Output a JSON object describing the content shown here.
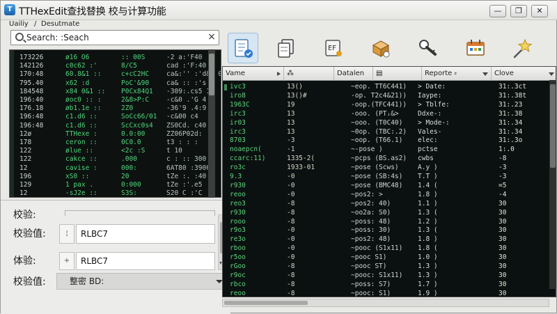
{
  "window": {
    "title": "TTHexEdit查找替换 校与计算功能",
    "minimize_glyph": "—",
    "maximize_glyph": "❐",
    "close_glyph": "✕"
  },
  "menu": {
    "items": [
      "Uailiy",
      "Desutmate"
    ],
    "separator": "/"
  },
  "search": {
    "value": "Search: :Seach",
    "placeholder": "Search",
    "clear_glyph": "×"
  },
  "hex_rows": [
    {
      "addr": "173226",
      "cols": [
        "ø16 O6",
        ":: 00S",
        "-2 a:'F40"
      ]
    },
    {
      "addr": "142126",
      "cols": [
        "c0c62 :'",
        "8/C5",
        "cad :'F:40"
      ]
    },
    {
      "addr": "170:48",
      "cols": [
        "60.8&1 ::",
        "c+cC2HC",
        "ca&:'' :'d&: 0"
      ]
    },
    {
      "addr": "795.40",
      "cols": [
        "x62 :d",
        "PoC'&90",
        "ca& :: :'s 1"
      ]
    },
    {
      "addr": "184548",
      "cols": [
        "x84 0&1 ::",
        "P0Cx84Q1",
        "-309:.cs5 1:"
      ]
    },
    {
      "addr": "196:40",
      "cols": [
        "øoc0 :: :",
        "2&8>P:C",
        "-c&0 .'G 4"
      ]
    },
    {
      "addr": "176.18",
      "cols": [
        "øb1.1e ::",
        "2Z0",
        "-36'9 .4:9"
      ]
    },
    {
      "addr": "196:48",
      "cols": [
        "c1.d6 ::",
        "SoCc66/01",
        "-c&00 c4"
      ]
    },
    {
      "addr": "196:48",
      "cols": [
        "c1.d6 ::",
        "ScCxc0s4",
        "ZS0Cd. c40"
      ]
    },
    {
      "addr": "12ø",
      "cols": [
        "TTHexe :",
        "0.0:00",
        "ZZ06P02d:"
      ]
    },
    {
      "addr": "178",
      "cols": [
        "ceron ::",
        "0C0.0",
        "t3 : : :"
      ]
    },
    {
      "addr": "122",
      "cols": [
        "ølue ::",
        "<2c :S",
        "t 10"
      ]
    },
    {
      "addr": "122",
      "cols": [
        "cakce ::",
        ".000",
        "c : :: 300"
      ]
    },
    {
      "addr": "12",
      "cols": [
        "cavise :",
        "000:",
        "6AT80 :3900"
      ]
    },
    {
      "addr": "196",
      "cols": [
        "xS0 ::",
        "20",
        "tZe :. :40"
      ]
    },
    {
      "addr": "129",
      "cols": [
        "1 pax .",
        "0:000",
        "tZe :'.e5"
      ]
    },
    {
      "addr": "12",
      "cols": [
        "-sJ2e ::",
        "S3S:",
        "S20 C :'C"
      ]
    }
  ],
  "form": {
    "label_1": "校验:",
    "label_2": "校验值:",
    "label_3": "体验:",
    "label_4": "校验值:",
    "field_2_value": "RLBC7",
    "field_3_value": "RLBC7",
    "spin_2": "¦",
    "spin_3": "+",
    "select_value": "整密 BD:",
    "scroll_arrow": "▾"
  },
  "toolbar": {
    "tools": [
      "checklist-icon",
      "copy-pages-icon",
      "hex-code-icon",
      "package-icon",
      "key-icon",
      "calendar-board-icon",
      "star-wand-icon"
    ]
  },
  "table": {
    "headers": [
      "Vame",
      "⁂",
      "Datalen",
      "▤",
      "Reporte ⸗",
      "Clove"
    ],
    "rows": [
      {
        "c1": "ivc3",
        "c2": "13()",
        "c3": "~eop. TT6C441)",
        "c4": "> Date:",
        "c5": "31:.3ct"
      },
      {
        "c1": "iro8",
        "c2": "13()#",
        "c3": "-op. T2c4&21))",
        "c4": "Iaype:",
        "c5": "31:.38t"
      },
      {
        "c1": "1963C",
        "c2": "19",
        "c3": "-oop.(TFC441))",
        "c4": "> Tblfe:",
        "c5": "31:.23"
      },
      {
        "c1": "irc3",
        "c2": "13",
        "c3": "-ooo. (PTᵢ&>",
        "c4": "Ddxe-:",
        "c5": "31:.38"
      },
      {
        "c1": "ir03",
        "c2": "13",
        "c3": "~ooo. (T0C40)",
        "c4": "> Mode-:",
        "c5": "31:.34"
      },
      {
        "c1": "irc3",
        "c2": "13",
        "c3": "~0op. (TBC:.2)",
        "c4": "Vales-",
        "c5": "31:.34"
      },
      {
        "c1": "8703",
        "c2": "-3",
        "c3": "~oop. (T66.1)",
        "c4": "elec:",
        "c5": "31:.3o"
      },
      {
        "c1": "noaepcn(",
        "c2": "-1",
        "c3": "~-pose  )",
        "c4": "pctse",
        "c5": "1:.0"
      },
      {
        "c1": "ccarc:11)",
        "c2": "1335-2(",
        "c3": "~pcps (BS.as2)",
        "c4": "cwbs",
        "c5": "-8"
      },
      {
        "c1": "ro3c",
        "c2": "1933-01",
        "c3": "~pose (Scws)",
        "c4": "A.y )",
        "c5": "-3"
      },
      {
        "c1": "9.3",
        "c2": "-0",
        "c3": "~pose (SB:4s)",
        "c4": "T.T )",
        "c5": "-3"
      },
      {
        "c1": "r930",
        "c2": "-0",
        "c3": "~pose (BMC48)",
        "c4": "1.4 (",
        "c5": "=5"
      },
      {
        "c1": "reoo",
        "c2": "-0",
        "c3": "~pos2: >",
        "c4": "1.8 )",
        "c5": "-4"
      },
      {
        "c1": "reo3",
        "c2": "-8",
        "c3": "~pos2: 40)",
        "c4": "1.1 )",
        "c5": "30"
      },
      {
        "c1": "r930",
        "c2": "-8",
        "c3": "~oo2a: S0)",
        "c4": "1.3 (",
        "c5": "30"
      },
      {
        "c1": "rooo",
        "c2": "-8",
        "c3": "~poss: 48)",
        "c4": "1.2 )",
        "c5": "30"
      },
      {
        "c1": "r9o3",
        "c2": "-0",
        "c3": "~poss: 30)",
        "c4": "1.3 (",
        "c5": "30"
      },
      {
        "c1": "re3o",
        "c2": "-0",
        "c3": "~pos2: 48)",
        "c4": "1.8 )",
        "c5": "30"
      },
      {
        "c1": "rboo",
        "c2": "-0",
        "c3": "~pooc (S1x11)",
        "c4": "1.8 (",
        "c5": "30"
      },
      {
        "c1": "r5oo",
        "c2": "-0",
        "c3": "~pooc S1)",
        "c4": "1.0 )",
        "c5": "30"
      },
      {
        "c1": "rGoo",
        "c2": "-8",
        "c3": "~pooc ST)",
        "c4": "1.3 )",
        "c5": "30"
      },
      {
        "c1": "r9oc",
        "c2": "-8",
        "c3": "~pooc: S1x11)",
        "c4": "1.3 )",
        "c5": "30"
      },
      {
        "c1": "rbco",
        "c2": "-8",
        "c3": "~poss: S7)",
        "c4": "1.7 )",
        "c5": "30"
      },
      {
        "c1": "reoo",
        "c2": "-8",
        "c3": "~pooc: S1)",
        "c4": "1.9 )",
        "c5": "30"
      }
    ]
  },
  "colors": {
    "accent": "#3e8a5a",
    "terminal_bg": "#0b1110",
    "hex_green": "#4fd67a"
  }
}
